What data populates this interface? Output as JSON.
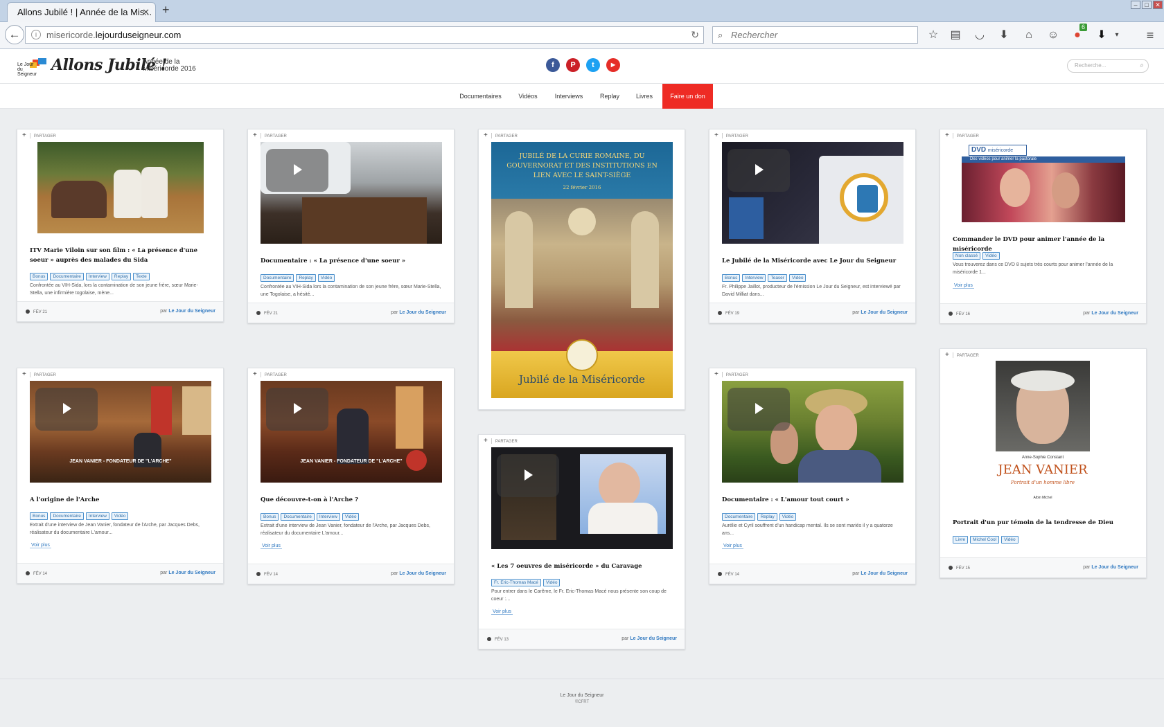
{
  "browser": {
    "tab_title": "Allons Jubilé ! | Année de la Mis...",
    "tab_close": "✕",
    "new_tab": "+",
    "url_pre": "misericorde.",
    "url_host": "lejourduseigneur.com",
    "search_placeholder": "Rechercher",
    "download_badge": "6"
  },
  "site": {
    "logo_text": "Le Jour du Seigneur",
    "brand": "Allons Jubilé !",
    "tagline": "Année de la Miséricorde 2016",
    "search_placeholder": "Recherche...",
    "socials": [
      "f",
      "P",
      "t",
      "▶"
    ],
    "menu": [
      "Documentaires",
      "Vidéos",
      "Interviews",
      "Replay",
      "Livres",
      "Faire un don"
    ]
  },
  "labels": {
    "share": "PARTAGER",
    "more": "Voir plus",
    "by_prefix": "par",
    "author": "Le Jour du Seigneur"
  },
  "cards": [
    {
      "title": "ITV Marie Viloin sur son film : « La présence d'une soeur » auprès des malades du Sida",
      "tags": [
        "Bonus",
        "Documentaire",
        "Interview",
        "Replay",
        "Texte"
      ],
      "desc": "Confrontée au VIH-Sida, lors la contamination de son jeune frère, sœur Marie-Stella, une infirmière togolaise, mène...",
      "date": "FÉV 21"
    },
    {
      "title": "Documentaire : « La présence d'une soeur »",
      "tags": [
        "Documentaire",
        "Replay",
        "Vidéo"
      ],
      "desc": "Confrontée au VIH-Sida lors la contamination de son jeune frère, sœur Marie-Stella, une Togolaise, a hésité...",
      "date": "FÉV 21"
    },
    {
      "poster_title": "JUBILÉ DE LA CURIE ROMAINE, DU GOUVERNORAT ET DES INSTITUTIONS EN LIEN AVEC LE SAINT-SIÈGE",
      "poster_date": "22 février 2016",
      "poster_footer": "Jubilé de la Miséricorde"
    },
    {
      "title": "Le Jubilé de la Miséricorde avec Le Jour du Seigneur",
      "tags": [
        "Bonus",
        "Interview",
        "Teaser",
        "Vidéo"
      ],
      "desc": "Fr. Philippe Jaillot, producteur de l'émission Le Jour du Seigneur, est interviewé par David Milliat dans...",
      "date": "FÉV 19"
    },
    {
      "dvd_label": "DVD",
      "dvd_sub": "miséricorde",
      "dvd_strap": "Des vidéos pour animer la pastorale",
      "title": "Commander le DVD pour animer l'année de la miséricorde",
      "tags": [
        "Non classé",
        "Vidéo"
      ],
      "desc": "Vous trouverez dans ce DVD 8 sujets très courts pour animer l'année de la miséricorde 1...",
      "date": "FÉV 16"
    },
    {
      "caption": "JEAN VANIER - FONDATEUR DE \"L'ARCHE\"",
      "title": "A l'origine de l'Arche",
      "tags": [
        "Bonus",
        "Documentaire",
        "Interview",
        "Vidéo"
      ],
      "desc": "Extrait d'une interview de Jean Vanier, fondateur de l'Arche, par Jacques Debs, réalisateur du documentaire L'amour...",
      "date": "FÉV 14"
    },
    {
      "caption": "JEAN VANIER - FONDATEUR DE \"L'ARCHE\"",
      "title": "Que découvre-t-on à l'Arche ?",
      "tags": [
        "Bonus",
        "Documentaire",
        "Interview",
        "Vidéo"
      ],
      "desc": "Extrait d'une interview de Jean Vanier, fondateur de l'Arche, par Jacques Debs, réalisateur du documentaire L'amour...",
      "date": "FÉV 14"
    },
    {
      "title": "« Les 7 oeuvres de miséricorde » du Caravage",
      "tags": [
        "Fr. Eric-Thomas Macé",
        "Vidéo"
      ],
      "desc": "Pour entrer dans le Carême, le Fr. Eric-Thomas Macé nous présente son coup de coeur :...",
      "date": "FÉV 13"
    },
    {
      "title": "Documentaire : « L'amour tout court »",
      "tags": [
        "Documentaire",
        "Replay",
        "Vidéo"
      ],
      "desc": "Aurélie et Cyril souffrent d'un handicap mental. Ils se sont mariés il y a quatorze ans...",
      "date": "FÉV 14"
    },
    {
      "book_author": "Anne-Sophie Constant",
      "book_title": "JEAN VANIER",
      "book_sub": "Portrait d'un homme libre",
      "book_pub": "Albin Michel",
      "title": "Portrait d'un pur témoin de la tendresse de Dieu",
      "tags": [
        "Livre",
        "Michel Cool",
        "Vidéo"
      ],
      "date": "FÉV 15"
    }
  ],
  "footer": {
    "line1": "Le Jour du Seigneur",
    "line2": "©CFRT"
  }
}
